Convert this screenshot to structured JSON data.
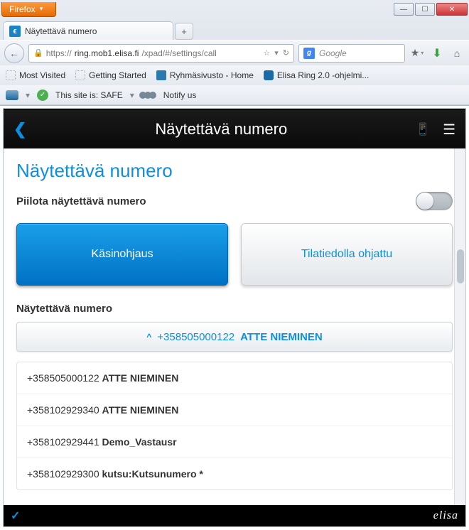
{
  "browser": {
    "name": "Firefox",
    "tab_title": "Näytettävä numero",
    "url_prefix": "https://",
    "url_host": "ring.mob1.elisa.fi",
    "url_path": "/xpad/#/settings/call",
    "search_placeholder": "Google",
    "bookmarks": [
      "Most Visited",
      "Getting Started",
      "Ryhmäsivusto - Home",
      "Elisa Ring 2.0 -ohjelmi..."
    ],
    "wot_label": "This site is: SAFE",
    "notify_label": "Notify us"
  },
  "app": {
    "header_title": "Näytettävä numero",
    "page_title": "Näytettävä numero",
    "hide_label": "Piilota näytettävä numero",
    "btn_manual": "Käsinohjaus",
    "btn_status": "Tilatiedolla ohjattu",
    "section_label": "Näytettävä numero",
    "selected": {
      "number": "+358505000122",
      "name": "ATTE NIEMINEN"
    },
    "numbers": [
      {
        "number": "+358505000122",
        "name": "ATTE NIEMINEN"
      },
      {
        "number": "+358102929340",
        "name": "ATTE NIEMINEN"
      },
      {
        "number": "+358102929441",
        "name": "Demo_Vastausr"
      },
      {
        "number": "+358102929300",
        "name": "kutsu:Kutsunumero *"
      }
    ],
    "brand": "elisa"
  }
}
